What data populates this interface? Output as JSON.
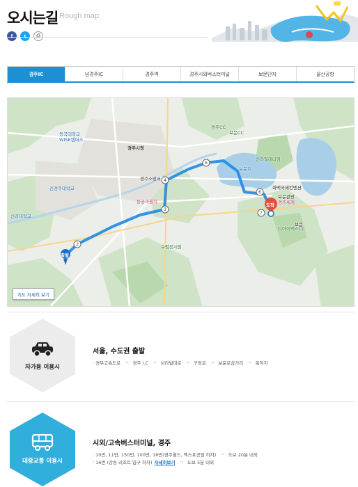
{
  "header": {
    "title": "오시는길",
    "subtitle": "Rough map"
  },
  "social": [
    {
      "name": "facebook-icon",
      "glyph": "f"
    },
    {
      "name": "twitter-icon",
      "glyph": "t"
    },
    {
      "name": "print-icon",
      "glyph": "⎙"
    }
  ],
  "tabs": [
    "경주IC",
    "남경주IC",
    "경주역",
    "경주시외버스터미널",
    "보문단지",
    "울산공항"
  ],
  "active_tab": 0,
  "map": {
    "labels": {
      "l1": "동국대학교",
      "l2": "WISE캠퍼스",
      "l3": "경주시청",
      "l4": "경주소방서",
      "l5": "동궁과월지",
      "l6": "신라대학교",
      "l7": "수렴전시원",
      "l8": "보문호",
      "l9": "보문CC",
      "l10": "경주CC",
      "l11": "신라밀레니엄",
      "l12": "보문관광",
      "l13": "디아이엑스CC",
      "l14": "경주세계",
      "l15": "화백국제컨벤션",
      "l16": "신경주대학교",
      "l17": "보문"
    },
    "start_label": "출발",
    "end_label": "도착",
    "detail_button": "지도 자세히 보기",
    "route_points": [
      "1",
      "2",
      "3",
      "4",
      "5",
      "6",
      "7"
    ]
  },
  "car": {
    "label": "자가용 이용시",
    "title": "서울, 수도권 출발",
    "route": [
      "경부고속도로",
      "경주 I.C",
      "서라벌대로",
      "구정로",
      "보문로삼거리",
      "목적지"
    ]
  },
  "bus": {
    "label": "대중교통 이용시",
    "title": "시외/고속버스터미널, 경주",
    "line1": {
      "text": "10번, 11번, 150번, 100번, 18번(경주월드, 엑스포공원 하차)",
      "walk": "도보 20분 내외"
    },
    "line2": {
      "text": "16번 (강동 리조트 입구 하차)",
      "link": "자세히보기",
      "walk": "도보 5분 내외"
    }
  },
  "colors": {
    "accent": "#1e8fd3",
    "route": "#1e88e5",
    "bus_hex": "#30aedc",
    "car_hex": "#ececec",
    "lake": "#a9cfe8"
  }
}
